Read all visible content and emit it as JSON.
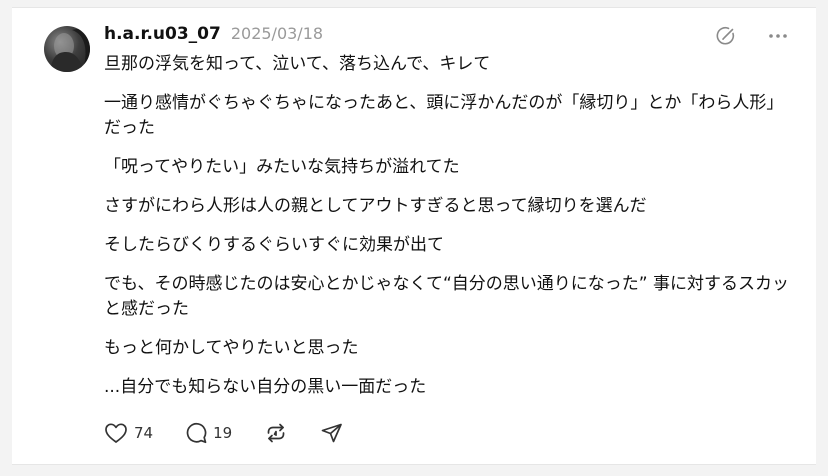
{
  "post": {
    "username": "h.a.r.u03_07",
    "timestamp": "2025/03/18",
    "paragraphs": [
      "旦那の浮気を知って、泣いて、落ち込んで、キレて",
      "一通り感情がぐちゃぐちゃになったあと、頭に浮かんだのが「縁切り」とか「わら人形」だった",
      "「呪ってやりたい」みたいな気持ちが溢れてた",
      "さすがにわら人形は人の親としてアウトすぎると思って縁切りを選んだ",
      "そしたらびくりするぐらいすぐに効果が出て",
      "でも、その時感じたのは安心とかじゃなくて“自分の思い通りになった” 事に対するスカッと感だった",
      "もっと何かしてやりたいと思った",
      "...自分でも知らない自分の黒い一面だった"
    ],
    "likes": "74",
    "replies": "19"
  },
  "icons": {
    "edit": "edit-circle-icon",
    "more": "more-icon",
    "like": "heart-icon",
    "reply": "comment-icon",
    "repost": "repost-icon",
    "share": "send-icon"
  }
}
